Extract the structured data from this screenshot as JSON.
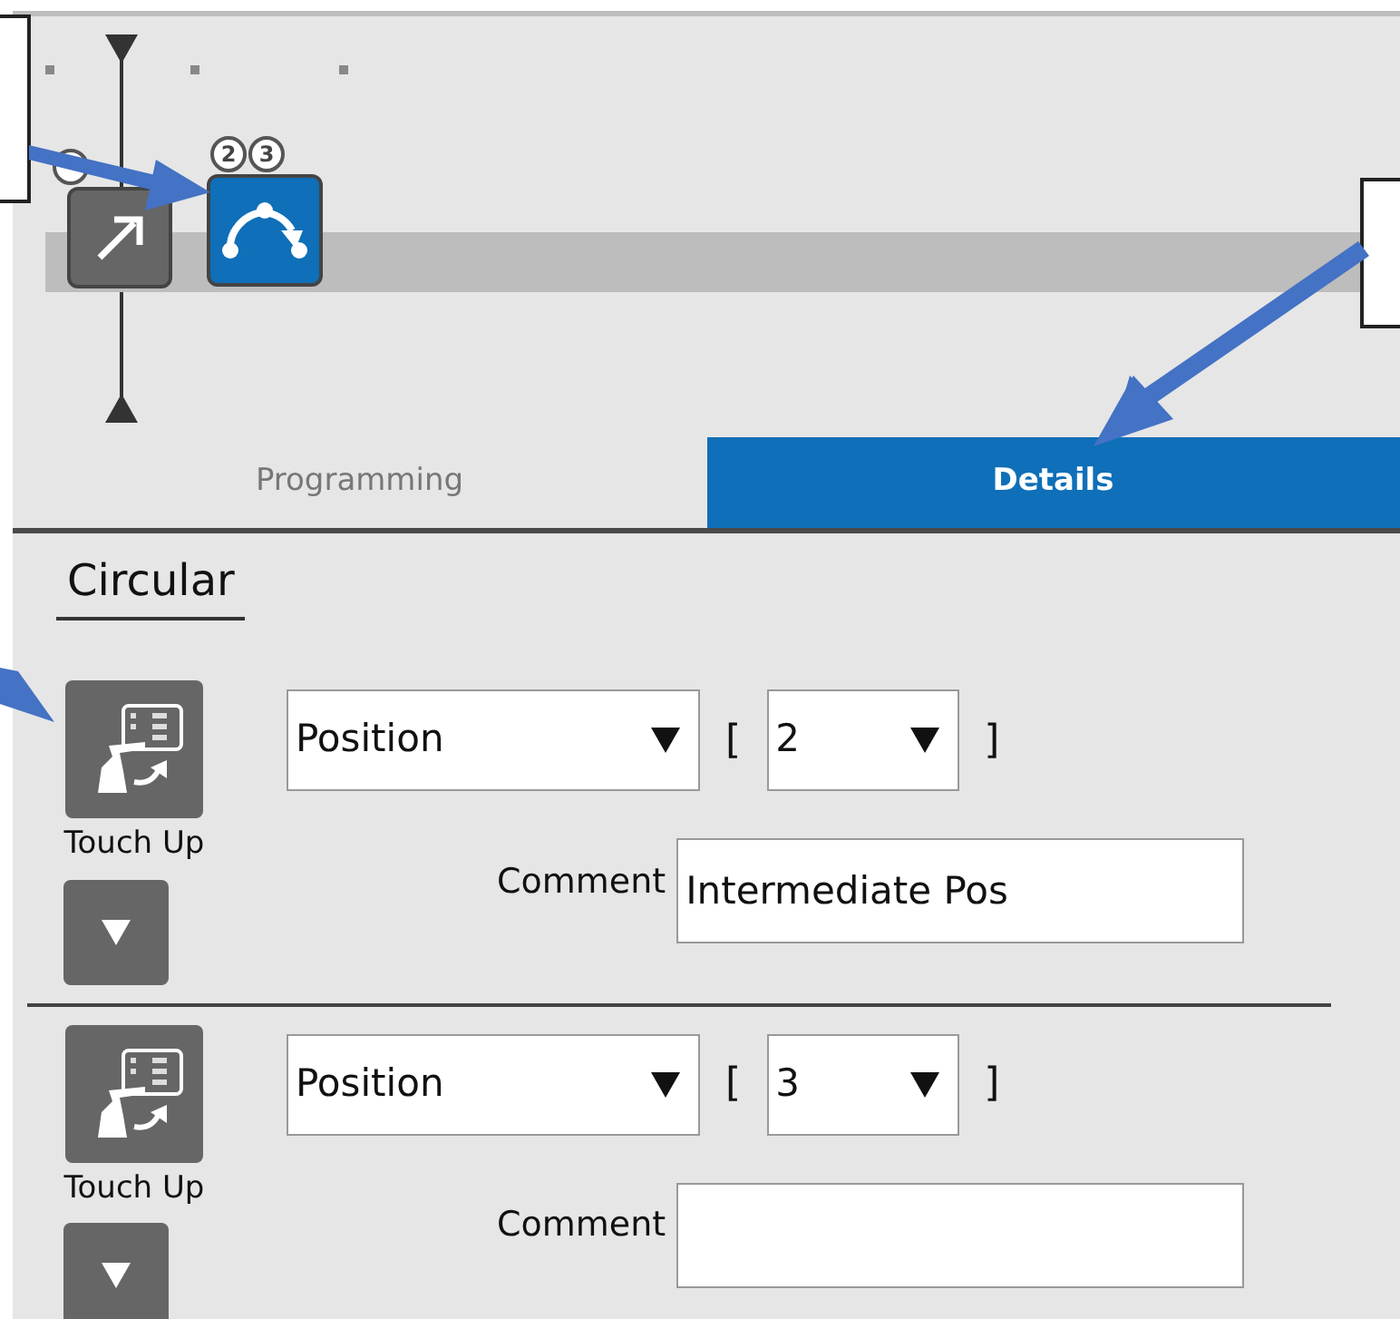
{
  "timeline": {
    "nodes": [
      {
        "kind": "linear",
        "selected": false,
        "badge_covered": true
      },
      {
        "kind": "circular",
        "selected": true,
        "badges": [
          "2",
          "3"
        ]
      }
    ]
  },
  "tabs": [
    {
      "label": "Programming",
      "selected": false
    },
    {
      "label": "Details",
      "selected": true
    }
  ],
  "section_title": "Circular",
  "points": [
    {
      "touch_up": "Touch Up",
      "type": "Position",
      "open_bracket": "[",
      "index": "2",
      "close_bracket": "]",
      "comment_label": "Comment",
      "comment": "Intermediate Pos"
    },
    {
      "touch_up": "Touch Up",
      "type": "Position",
      "open_bracket": "[",
      "index": "3",
      "close_bracket": "]",
      "comment_label": "Comment"
    }
  ]
}
